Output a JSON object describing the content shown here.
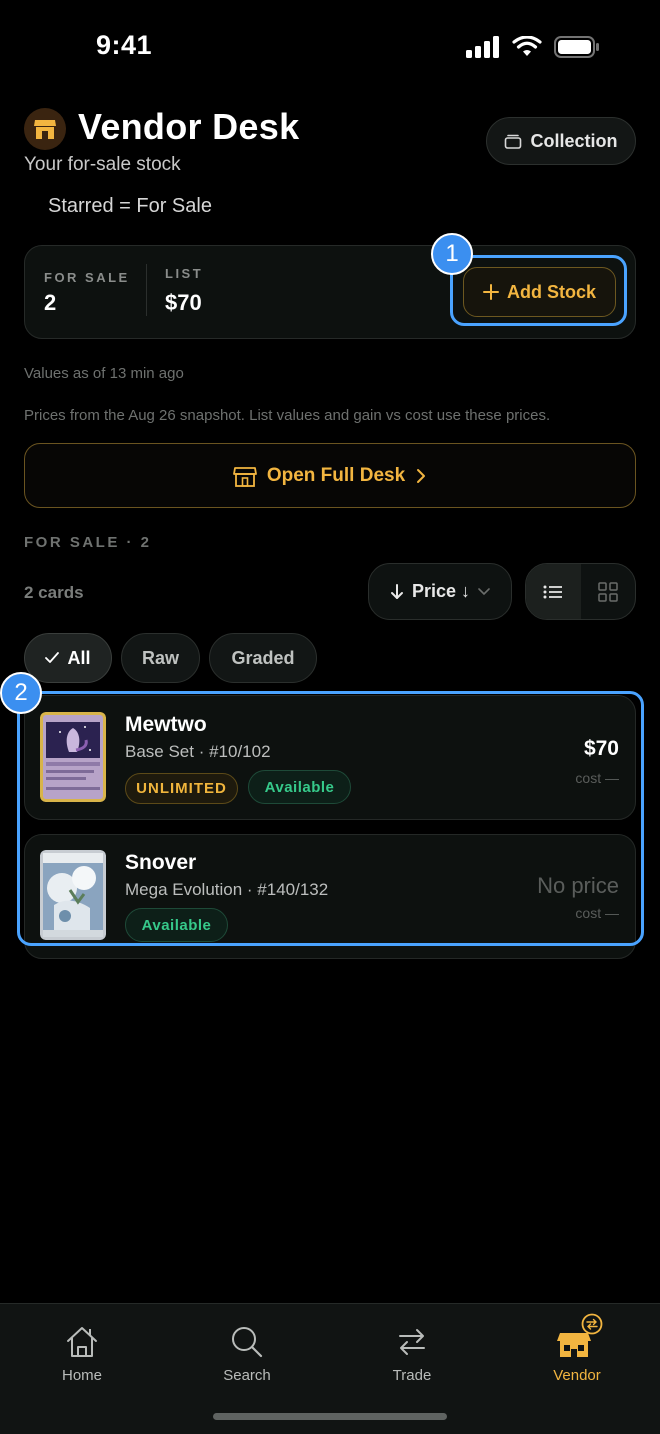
{
  "status_bar": {
    "time": "9:41"
  },
  "header": {
    "title": "Vendor Desk",
    "subtitle": "Your for-sale stock",
    "note": "Starred = For Sale",
    "collection_label": "Collection"
  },
  "stats": {
    "for_sale_label": "FOR SALE",
    "for_sale_value": "2",
    "list_label": "LIST",
    "list_value": "$70",
    "add_stock_label": "Add Stock"
  },
  "annotations": {
    "badge_1": "1",
    "badge_2": "2"
  },
  "meta": {
    "updated": "Values as of 13 min ago",
    "snapshot_note": "Prices from the Aug 26 snapshot. List values and gain vs cost use these prices."
  },
  "open_desk_label": "Open Full Desk",
  "section": {
    "label": "FOR SALE · 2",
    "count": "2 cards",
    "sort_label": "Price ↓"
  },
  "filters": [
    {
      "label": "All",
      "active": true
    },
    {
      "label": "Raw",
      "active": false
    },
    {
      "label": "Graded",
      "active": false
    }
  ],
  "cards": [
    {
      "name": "Mewtwo",
      "set": "Base Set · #10/102",
      "tags": [
        "UNLIMITED",
        "Available"
      ],
      "price": "$70",
      "cost": "cost —"
    },
    {
      "name": "Snover",
      "set": "Mega Evolution · #140/132",
      "tags": [
        "Available"
      ],
      "price": "No price",
      "cost": "cost —"
    }
  ],
  "tabs": [
    {
      "label": "Home",
      "icon": "home-icon"
    },
    {
      "label": "Search",
      "icon": "search-icon"
    },
    {
      "label": "Trade",
      "icon": "trade-icon"
    },
    {
      "label": "Vendor",
      "icon": "vendor-store-icon",
      "active": true
    }
  ],
  "colors": {
    "accent": "#f2b540",
    "success": "#36c98a",
    "highlight": "#4aa3ff"
  }
}
